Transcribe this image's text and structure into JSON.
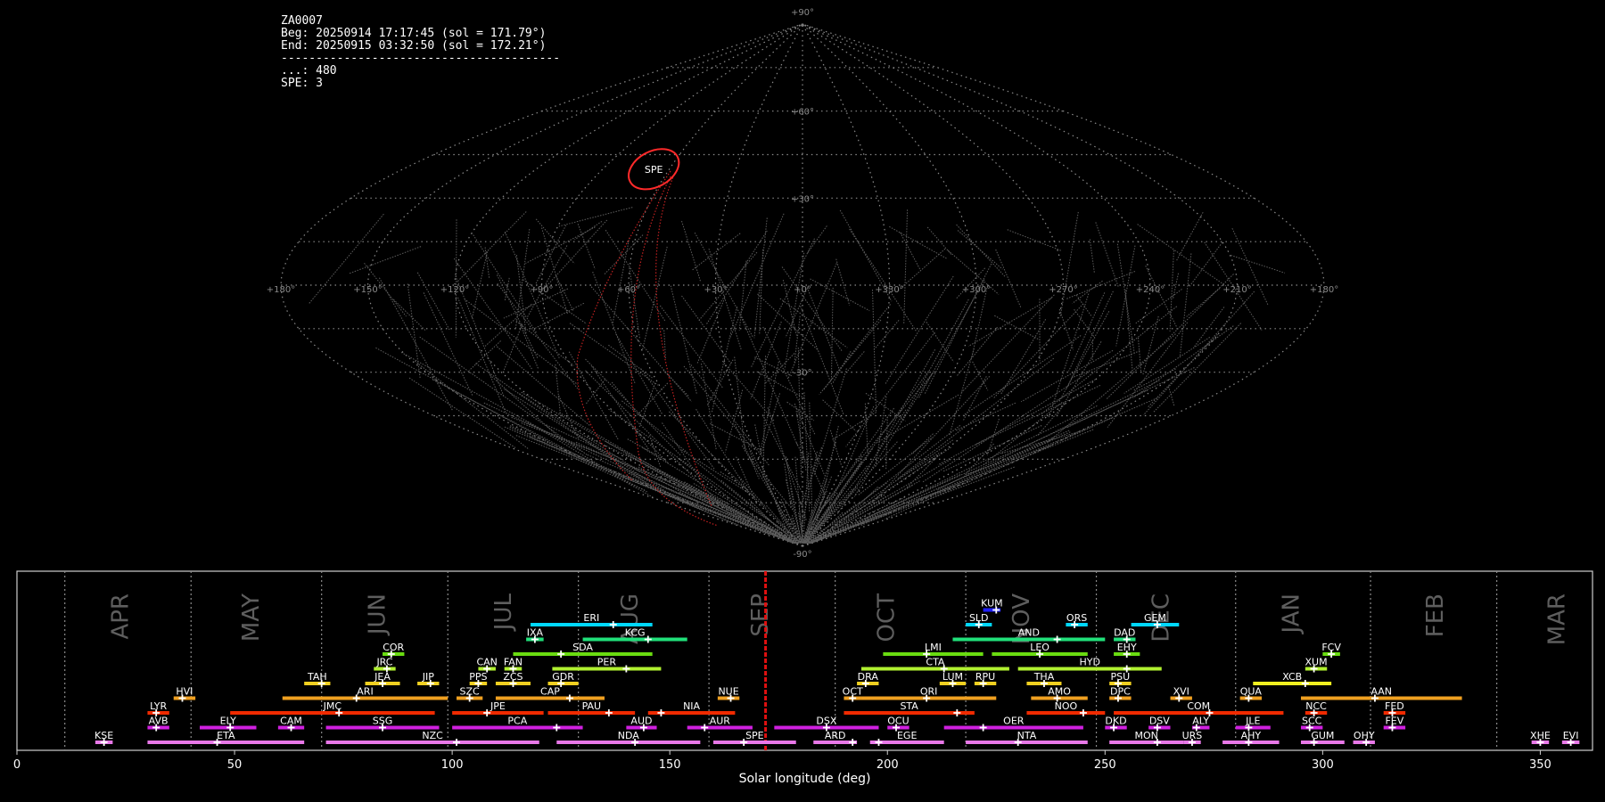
{
  "info": {
    "camera": "ZA0007",
    "beg": "Beg: 20250914 17:17:45 (sol = 171.79°)",
    "end": "End: 20250915 03:32:50 (sol = 172.21°)",
    "separator": "----------------------------------------",
    "count_line": "...: 480",
    "spe_line": "SPE: 3"
  },
  "chart_data": [
    {
      "type": "scatter",
      "projection": "sinusoidal",
      "lat_ticks": [
        "+90°",
        "+60°",
        "+30°",
        "-30°",
        "-90°"
      ],
      "lon_ticks": [
        "+180°",
        "+150°",
        "+120°",
        "+90°",
        "+60°",
        "+30°",
        "+0°",
        "+330°",
        "+300°",
        "+270°",
        "+240°",
        "+210°",
        "+180°"
      ],
      "highlight": {
        "label": "SPE",
        "lon": 67,
        "lat": 40,
        "color": "#ff2a2a"
      },
      "radiants_count": 480
    },
    {
      "type": "bar",
      "xlabel": "Solar longitude (deg)",
      "xlim": [
        0,
        362
      ],
      "xticks": [
        0,
        50,
        100,
        150,
        200,
        250,
        300,
        350
      ],
      "current_sol": 172.0,
      "months": [
        {
          "name": "APR",
          "sol": 24
        },
        {
          "name": "MAY",
          "sol": 54
        },
        {
          "name": "JUN",
          "sol": 83
        },
        {
          "name": "JUL",
          "sol": 112
        },
        {
          "name": "AUG",
          "sol": 141
        },
        {
          "name": "SEP",
          "sol": 171
        },
        {
          "name": "OCT",
          "sol": 200
        },
        {
          "name": "NOV",
          "sol": 231
        },
        {
          "name": "DEC",
          "sol": 263
        },
        {
          "name": "JAN",
          "sol": 293
        },
        {
          "name": "FEB",
          "sol": 326
        },
        {
          "name": "MAR",
          "sol": 354
        }
      ],
      "month_lines": [
        11,
        40,
        70,
        99,
        129,
        159,
        188,
        218,
        248,
        280,
        311,
        340
      ],
      "showers": [
        {
          "code": "KUM",
          "start": 222,
          "end": 226,
          "peak": 225,
          "row": 9,
          "color": "#2020ff"
        },
        {
          "code": "ERI",
          "start": 118,
          "end": 146,
          "peak": 137,
          "row": 8,
          "color": "#00d8ff"
        },
        {
          "code": "SLD",
          "start": 218,
          "end": 224,
          "peak": 221,
          "row": 8,
          "color": "#00d8ff"
        },
        {
          "code": "ORS",
          "start": 241,
          "end": 246,
          "peak": 243,
          "row": 8,
          "color": "#00d8ff"
        },
        {
          "code": "GEM",
          "start": 256,
          "end": 267,
          "peak": 262,
          "row": 8,
          "color": "#00d8ff"
        },
        {
          "code": "IXA",
          "start": 117,
          "end": 121,
          "peak": 119,
          "row": 7,
          "color": "#20e07a"
        },
        {
          "code": "KCG",
          "start": 130,
          "end": 154,
          "peak": 145,
          "row": 7,
          "color": "#20e07a"
        },
        {
          "code": "AND",
          "start": 215,
          "end": 250,
          "peak": 239,
          "row": 7,
          "color": "#20e07a"
        },
        {
          "code": "DAD",
          "start": 252,
          "end": 257,
          "peak": 255,
          "row": 7,
          "color": "#20e07a"
        },
        {
          "code": "COR",
          "start": 84,
          "end": 89,
          "peak": 86,
          "row": 6,
          "color": "#6adc10"
        },
        {
          "code": "SDA",
          "start": 114,
          "end": 146,
          "peak": 125,
          "row": 6,
          "color": "#6adc10"
        },
        {
          "code": "LMI",
          "start": 199,
          "end": 222,
          "peak": 209,
          "row": 6,
          "color": "#6adc10"
        },
        {
          "code": "LEO",
          "start": 224,
          "end": 246,
          "peak": 235,
          "row": 6,
          "color": "#6adc10"
        },
        {
          "code": "EHY",
          "start": 252,
          "end": 258,
          "peak": 255,
          "row": 6,
          "color": "#6adc10"
        },
        {
          "code": "FCV",
          "start": 300,
          "end": 304,
          "peak": 302,
          "row": 6,
          "color": "#6adc10"
        },
        {
          "code": "JRC",
          "start": 82,
          "end": 87,
          "peak": 85,
          "row": 5,
          "color": "#b0f030"
        },
        {
          "code": "CAN",
          "start": 106,
          "end": 110,
          "peak": 108,
          "row": 5,
          "color": "#b0f030"
        },
        {
          "code": "FAN",
          "start": 112,
          "end": 116,
          "peak": 114,
          "row": 5,
          "color": "#b0f030"
        },
        {
          "code": "PER",
          "start": 123,
          "end": 148,
          "peak": 140,
          "row": 5,
          "color": "#b0f030"
        },
        {
          "code": "CTA",
          "start": 194,
          "end": 228,
          "peak": 213,
          "row": 5,
          "color": "#b0f030"
        },
        {
          "code": "HYD",
          "start": 230,
          "end": 263,
          "peak": 255,
          "row": 5,
          "color": "#b0f030"
        },
        {
          "code": "XUM",
          "start": 296,
          "end": 301,
          "peak": 298,
          "row": 5,
          "color": "#b0f030"
        },
        {
          "code": "TAH",
          "start": 66,
          "end": 72,
          "peak": 70,
          "row": 4,
          "color": "#f0d020"
        },
        {
          "code": "JEA",
          "start": 80,
          "end": 88,
          "peak": 84,
          "row": 4,
          "color": "#f0d020"
        },
        {
          "code": "JIP",
          "start": 92,
          "end": 97,
          "peak": 95,
          "row": 4,
          "color": "#f0d020"
        },
        {
          "code": "PPS",
          "start": 104,
          "end": 108,
          "peak": 106,
          "row": 4,
          "color": "#f0d020"
        },
        {
          "code": "ZCS",
          "start": 110,
          "end": 118,
          "peak": 114,
          "row": 4,
          "color": "#f0d020"
        },
        {
          "code": "GDR",
          "start": 122,
          "end": 129,
          "peak": 125,
          "row": 4,
          "color": "#f0d020"
        },
        {
          "code": "DRA",
          "start": 193,
          "end": 198,
          "peak": 195,
          "row": 4,
          "color": "#f0d020"
        },
        {
          "code": "LUM",
          "start": 212,
          "end": 218,
          "peak": 215,
          "row": 4,
          "color": "#f0d020"
        },
        {
          "code": "RPU",
          "start": 220,
          "end": 225,
          "peak": 222,
          "row": 4,
          "color": "#f0d020"
        },
        {
          "code": "THA",
          "start": 232,
          "end": 240,
          "peak": 236,
          "row": 4,
          "color": "#f0d020"
        },
        {
          "code": "PSU",
          "start": 251,
          "end": 256,
          "peak": 253,
          "row": 4,
          "color": "#f0d020"
        },
        {
          "code": "XCB",
          "start": 284,
          "end": 302,
          "peak": 296,
          "row": 4,
          "color": "#f0f020"
        },
        {
          "code": "HVI",
          "start": 36,
          "end": 41,
          "peak": 38,
          "row": 3,
          "color": "#f0a020"
        },
        {
          "code": "ARI",
          "start": 61,
          "end": 99,
          "peak": 78,
          "row": 3,
          "color": "#f0a020"
        },
        {
          "code": "SZC",
          "start": 101,
          "end": 107,
          "peak": 104,
          "row": 3,
          "color": "#f0a020"
        },
        {
          "code": "CAP",
          "start": 110,
          "end": 135,
          "peak": 127,
          "row": 3,
          "color": "#f0a020"
        },
        {
          "code": "NUE",
          "start": 161,
          "end": 166,
          "peak": 164,
          "row": 3,
          "color": "#f0a020"
        },
        {
          "code": "OCT",
          "start": 190,
          "end": 194,
          "peak": 192,
          "row": 3,
          "color": "#f0a020"
        },
        {
          "code": "ORI",
          "start": 194,
          "end": 225,
          "peak": 209,
          "row": 3,
          "color": "#f0a020"
        },
        {
          "code": "AMO",
          "start": 233,
          "end": 246,
          "peak": 239,
          "row": 3,
          "color": "#f0a020"
        },
        {
          "code": "DPC",
          "start": 251,
          "end": 256,
          "peak": 253,
          "row": 3,
          "color": "#f0a020"
        },
        {
          "code": "XVI",
          "start": 265,
          "end": 270,
          "peak": 267,
          "row": 3,
          "color": "#f0a020"
        },
        {
          "code": "QUA",
          "start": 281,
          "end": 286,
          "peak": 283,
          "row": 3,
          "color": "#f0a020"
        },
        {
          "code": "AAN",
          "start": 295,
          "end": 332,
          "peak": 312,
          "row": 3,
          "color": "#f0a020"
        },
        {
          "code": "LYR",
          "start": 30,
          "end": 35,
          "peak": 32,
          "row": 2,
          "color": "#f02a00"
        },
        {
          "code": "JMC",
          "start": 49,
          "end": 96,
          "peak": 74,
          "row": 2,
          "color": "#f02a00"
        },
        {
          "code": "JPE",
          "start": 100,
          "end": 121,
          "peak": 108,
          "row": 2,
          "color": "#f02a00"
        },
        {
          "code": "PAU",
          "start": 122,
          "end": 142,
          "peak": 136,
          "row": 2,
          "color": "#f02a00"
        },
        {
          "code": "NIA",
          "start": 145,
          "end": 165,
          "peak": 148,
          "row": 2,
          "color": "#f02a00"
        },
        {
          "code": "STA",
          "start": 190,
          "end": 220,
          "peak": 216,
          "row": 2,
          "color": "#f02a00"
        },
        {
          "code": "NOO",
          "start": 232,
          "end": 250,
          "peak": 245,
          "row": 2,
          "color": "#f02a00"
        },
        {
          "code": "COM",
          "start": 252,
          "end": 291,
          "peak": 274,
          "row": 2,
          "color": "#f02a00"
        },
        {
          "code": "NCC",
          "start": 296,
          "end": 301,
          "peak": 298,
          "row": 2,
          "color": "#f02a00"
        },
        {
          "code": "FED",
          "start": 314,
          "end": 319,
          "peak": 316,
          "row": 2,
          "color": "#f02a00"
        },
        {
          "code": "AVB",
          "start": 30,
          "end": 35,
          "peak": 32,
          "row": 1,
          "color": "#d020e0"
        },
        {
          "code": "ELY",
          "start": 42,
          "end": 55,
          "peak": 49,
          "row": 1,
          "color": "#d020e0"
        },
        {
          "code": "CAM",
          "start": 60,
          "end": 66,
          "peak": 63,
          "row": 1,
          "color": "#d020e0"
        },
        {
          "code": "SSG",
          "start": 71,
          "end": 97,
          "peak": 84,
          "row": 1,
          "color": "#d020e0"
        },
        {
          "code": "PCA",
          "start": 100,
          "end": 130,
          "peak": 124,
          "row": 1,
          "color": "#d020e0"
        },
        {
          "code": "AUD",
          "start": 140,
          "end": 147,
          "peak": 144,
          "row": 1,
          "color": "#d020e0"
        },
        {
          "code": "AUR",
          "start": 154,
          "end": 169,
          "peak": 158,
          "row": 1,
          "color": "#d020e0"
        },
        {
          "code": "DSX",
          "start": 174,
          "end": 198,
          "peak": 186,
          "row": 1,
          "color": "#d020e0"
        },
        {
          "code": "OCU",
          "start": 200,
          "end": 205,
          "peak": 202,
          "row": 1,
          "color": "#d020e0"
        },
        {
          "code": "OER",
          "start": 213,
          "end": 245,
          "peak": 222,
          "row": 1,
          "color": "#d020e0"
        },
        {
          "code": "DKD",
          "start": 250,
          "end": 255,
          "peak": 252,
          "row": 1,
          "color": "#d020e0"
        },
        {
          "code": "DSV",
          "start": 260,
          "end": 265,
          "peak": 262,
          "row": 1,
          "color": "#d020e0"
        },
        {
          "code": "ALY",
          "start": 270,
          "end": 274,
          "peak": 271,
          "row": 1,
          "color": "#d020e0"
        },
        {
          "code": "JLE",
          "start": 280,
          "end": 288,
          "peak": 283,
          "row": 1,
          "color": "#d020e0"
        },
        {
          "code": "SCC",
          "start": 295,
          "end": 300,
          "peak": 297,
          "row": 1,
          "color": "#d020e0"
        },
        {
          "code": "FEV",
          "start": 314,
          "end": 319,
          "peak": 316,
          "row": 1,
          "color": "#d020e0"
        },
        {
          "code": "KSE",
          "start": 18,
          "end": 22,
          "peak": 20,
          "row": 0,
          "color": "#e878e8"
        },
        {
          "code": "ETA",
          "start": 30,
          "end": 66,
          "peak": 46,
          "row": 0,
          "color": "#e878e8"
        },
        {
          "code": "NZC",
          "start": 71,
          "end": 120,
          "peak": 101,
          "row": 0,
          "color": "#e878e8"
        },
        {
          "code": "NDA",
          "start": 124,
          "end": 157,
          "peak": 142,
          "row": 0,
          "color": "#e878e8"
        },
        {
          "code": "SPE",
          "start": 160,
          "end": 179,
          "peak": 167,
          "row": 0,
          "color": "#e878e8"
        },
        {
          "code": "ARD",
          "start": 183,
          "end": 193,
          "peak": 192,
          "row": 0,
          "color": "#e878e8"
        },
        {
          "code": "EGE",
          "start": 196,
          "end": 213,
          "peak": 198,
          "row": 0,
          "color": "#e878e8"
        },
        {
          "code": "NTA",
          "start": 218,
          "end": 246,
          "peak": 230,
          "row": 0,
          "color": "#e878e8"
        },
        {
          "code": "MON",
          "start": 251,
          "end": 268,
          "peak": 262,
          "row": 0,
          "color": "#e878e8"
        },
        {
          "code": "URS",
          "start": 268,
          "end": 272,
          "peak": 270,
          "row": 0,
          "color": "#e878e8"
        },
        {
          "code": "AHY",
          "start": 277,
          "end": 290,
          "peak": 283,
          "row": 0,
          "color": "#e878e8"
        },
        {
          "code": "GUM",
          "start": 295,
          "end": 305,
          "peak": 298,
          "row": 0,
          "color": "#e878e8"
        },
        {
          "code": "OHY",
          "start": 307,
          "end": 312,
          "peak": 310,
          "row": 0,
          "color": "#e878e8"
        },
        {
          "code": "XHE",
          "start": 348,
          "end": 352,
          "peak": 350,
          "row": 0,
          "color": "#e878e8"
        },
        {
          "code": "EVI",
          "start": 355,
          "end": 359,
          "peak": 357,
          "row": 0,
          "color": "#e878e8"
        }
      ]
    }
  ]
}
